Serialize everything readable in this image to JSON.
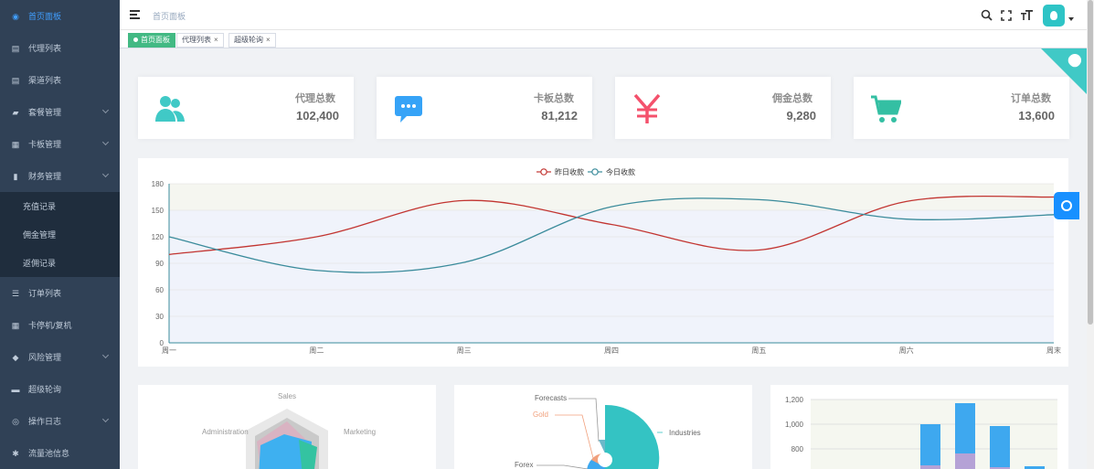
{
  "sidebar": {
    "items": [
      {
        "label": "首页面板",
        "icon": "dashboard-icon",
        "active": true
      },
      {
        "label": "代理列表",
        "icon": "list-icon"
      },
      {
        "label": "渠道列表",
        "icon": "list-icon"
      },
      {
        "label": "套餐管理",
        "icon": "lock-icon",
        "has_children": true
      },
      {
        "label": "卡板管理",
        "icon": "grid-icon",
        "has_children": true
      },
      {
        "label": "财务管理",
        "icon": "bar-chart-icon",
        "has_children": true,
        "expanded": true
      }
    ],
    "sub_items": [
      {
        "label": "充值记录"
      },
      {
        "label": "佣金管理"
      },
      {
        "label": "返佣记录"
      }
    ],
    "items_after": [
      {
        "label": "订单列表",
        "icon": "document-icon"
      },
      {
        "label": "卡停机/复机",
        "icon": "table-icon"
      },
      {
        "label": "风险管理",
        "icon": "shield-icon",
        "has_children": true
      },
      {
        "label": "超级轮询",
        "icon": "folder-icon"
      },
      {
        "label": "操作日志",
        "icon": "log-icon",
        "has_children": true
      },
      {
        "label": "流量池信息",
        "icon": "pool-icon"
      }
    ]
  },
  "navbar": {
    "breadcrumb": "首页面板",
    "icons": [
      "search-icon",
      "fullscreen-icon",
      "font-size-icon"
    ]
  },
  "tags": [
    {
      "label": "首页面板",
      "active": true
    },
    {
      "label": "代理列表",
      "closable": true
    },
    {
      "label": "超级轮询",
      "closable": true
    }
  ],
  "cards": [
    {
      "title": "代理总数",
      "value": "102,400",
      "icon": "people-icon",
      "color": "#40c9c6"
    },
    {
      "title": "卡板总数",
      "value": "81,212",
      "icon": "message-icon",
      "color": "#36a3f7"
    },
    {
      "title": "佣金总数",
      "value": "9,280",
      "icon": "money-icon",
      "color": "#f4516c"
    },
    {
      "title": "订单总数",
      "value": "13,600",
      "icon": "shopping-icon",
      "color": "#34bfa3"
    }
  ],
  "chart_data": [
    {
      "type": "line",
      "categories": [
        "周一",
        "周二",
        "周三",
        "周四",
        "周五",
        "周六",
        "周末"
      ],
      "series": [
        {
          "name": "昨日收款",
          "values": [
            100,
            120,
            161,
            134,
            105,
            160,
            165
          ],
          "color": "#c23531"
        },
        {
          "name": "今日收款",
          "values": [
            120,
            82,
            91,
            154,
            162,
            140,
            145
          ],
          "color": "#3a8b9b"
        }
      ],
      "ylim": [
        0,
        180
      ],
      "yticks": [
        0,
        30,
        60,
        90,
        120,
        150,
        180
      ],
      "legend": "top-center",
      "grid": true
    },
    {
      "type": "radar",
      "indicators": [
        "Sales",
        "Administration",
        "Marketing"
      ]
    },
    {
      "type": "pie",
      "labels": [
        "Forecasts",
        "Gold",
        "Forex",
        "Industries"
      ]
    },
    {
      "type": "bar",
      "yticks": [
        "800",
        "1,000",
        "1,200"
      ]
    }
  ]
}
